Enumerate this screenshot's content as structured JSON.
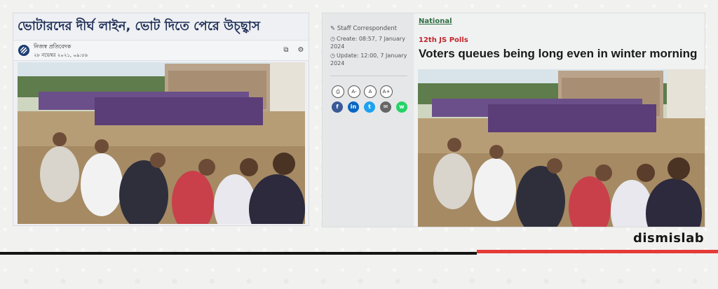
{
  "left_article": {
    "title": "ভোটারদের দীর্ঘ লাইন, ভোট দিতে পেরে উচ্ছ্বাস",
    "author": "নিজস্ব প্রতিবেদক",
    "date": "২৮ নভেম্বর ২০২১, ০৯:৫৬",
    "icons": [
      "copy-icon",
      "settings-icon"
    ]
  },
  "right_article": {
    "byline": "Staff Correspondent",
    "created": "Create: 08:57, 7 January 2024",
    "updated": "Update: 12:00, 7 January 2024",
    "section": "National",
    "kicker": "12th JS Polls",
    "headline": "Voters queues being long even in winter morning",
    "tools": [
      "A-",
      "A",
      "A+"
    ],
    "social": [
      {
        "name": "facebook-icon",
        "glyph": "f",
        "color": "#3b5998"
      },
      {
        "name": "linkedin-icon",
        "glyph": "in",
        "color": "#0a66c2"
      },
      {
        "name": "twitter-icon",
        "glyph": "t",
        "color": "#1da1f2"
      },
      {
        "name": "email-icon",
        "glyph": "✉",
        "color": "#666666"
      },
      {
        "name": "whatsapp-icon",
        "glyph": "w",
        "color": "#25d366"
      }
    ]
  },
  "brand": {
    "name": "dismislab",
    "accent": "#e53a36"
  }
}
